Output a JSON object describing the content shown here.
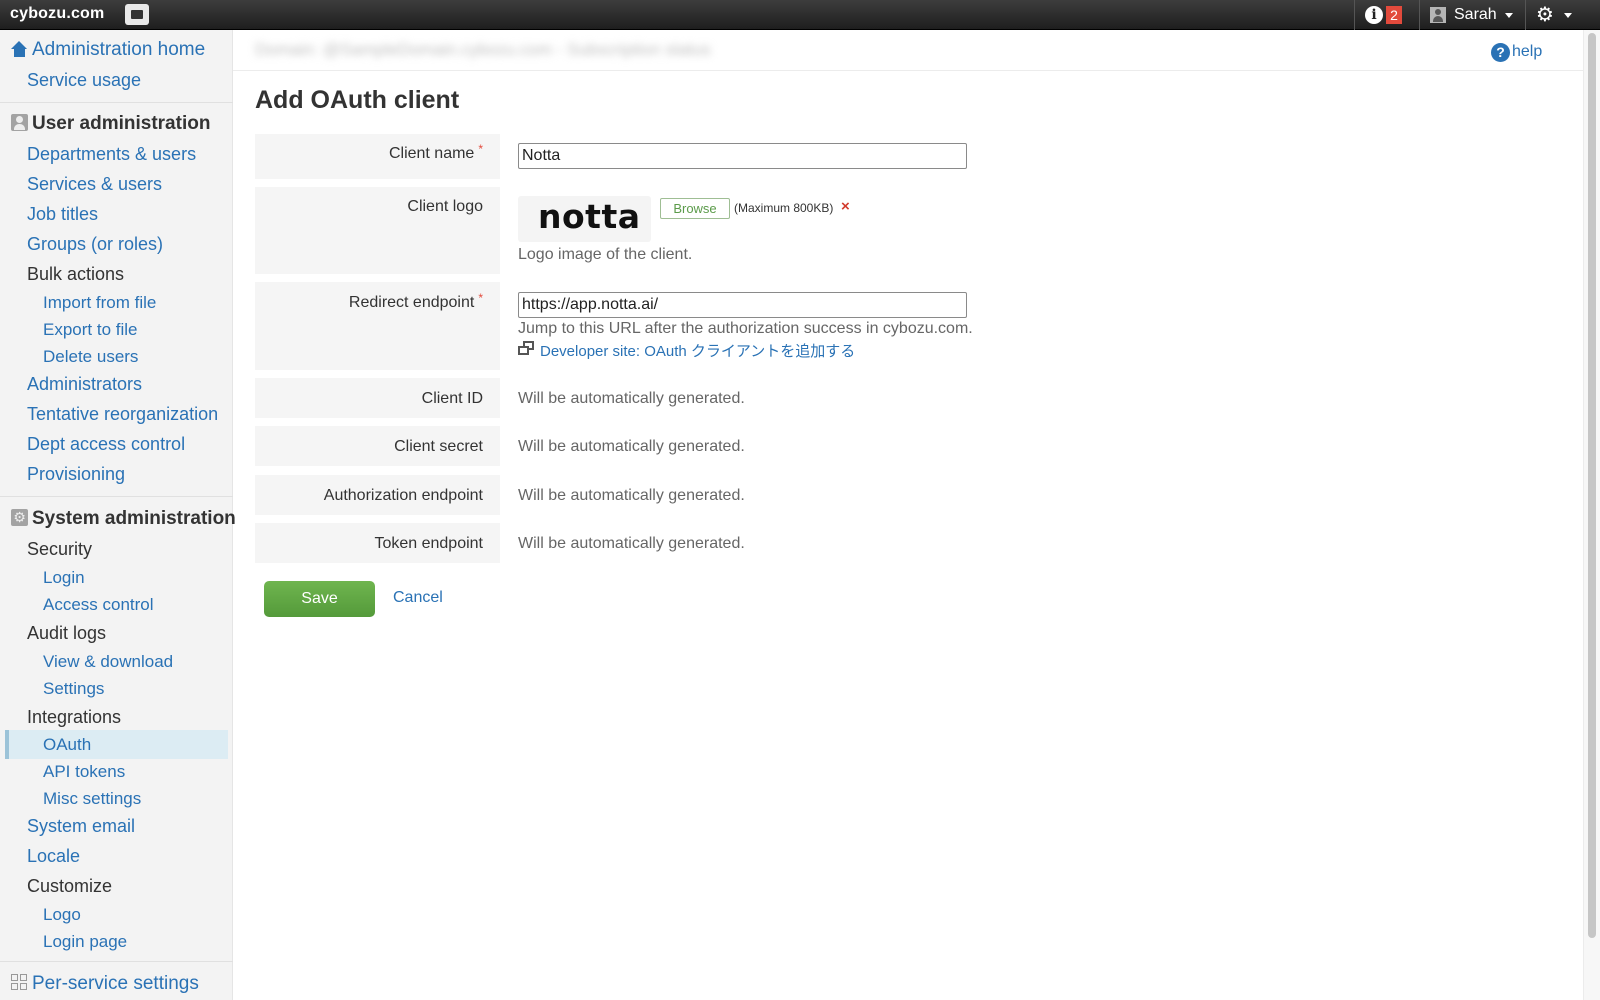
{
  "topbar": {
    "brand": "cybozu.com",
    "notification_count": "2",
    "user_name": "Sarah"
  },
  "sidebar": {
    "admin_home": "Administration home",
    "service_usage": "Service usage",
    "user_admin": {
      "title": "User administration",
      "departments_users": "Departments & users",
      "services_users": "Services & users",
      "job_titles": "Job titles",
      "groups_roles": "Groups (or roles)",
      "bulk_actions": "Bulk actions",
      "import_from_file": "Import from file",
      "export_to_file": "Export to file",
      "delete_users": "Delete users",
      "administrators": "Administrators",
      "tentative_reorganization": "Tentative reorganization",
      "dept_access_control": "Dept access control",
      "provisioning": "Provisioning"
    },
    "system_admin": {
      "title": "System administration",
      "security": "Security",
      "login": "Login",
      "access_control": "Access control",
      "audit_logs": "Audit logs",
      "view_download": "View & download",
      "settings": "Settings",
      "integrations": "Integrations",
      "oauth": "OAuth",
      "api_tokens": "API tokens",
      "misc_settings": "Misc settings",
      "system_email": "System email",
      "locale": "Locale",
      "customize": "Customize",
      "logo": "Logo",
      "login_page": "Login page"
    },
    "per_service": "Per-service settings"
  },
  "header": {
    "breadcrumb": "Domain: @SampleDomain.cybozu.com - Subscription status",
    "help": "help"
  },
  "form": {
    "title": "Add OAuth client",
    "client_name": {
      "label": "Client name",
      "value": "Notta"
    },
    "client_logo": {
      "label": "Client logo",
      "logo_text": "notta",
      "browse": "Browse",
      "max_size": "(Maximum 800KB)",
      "remove": "×",
      "hint": "Logo image of the client."
    },
    "redirect_endpoint": {
      "label": "Redirect endpoint",
      "value": "https://app.notta.ai/",
      "hint": "Jump to this URL after the authorization success in cybozu.com.",
      "dev_link": "Developer site: OAuth クライアントを追加する"
    },
    "client_id": {
      "label": "Client ID",
      "value": "Will be automatically generated."
    },
    "client_secret": {
      "label": "Client secret",
      "value": "Will be automatically generated."
    },
    "authorization_endpoint": {
      "label": "Authorization endpoint",
      "value": "Will be automatically generated."
    },
    "token_endpoint": {
      "label": "Token endpoint",
      "value": "Will be automatically generated."
    },
    "required_mark": "*",
    "save": "Save",
    "cancel": "Cancel"
  }
}
